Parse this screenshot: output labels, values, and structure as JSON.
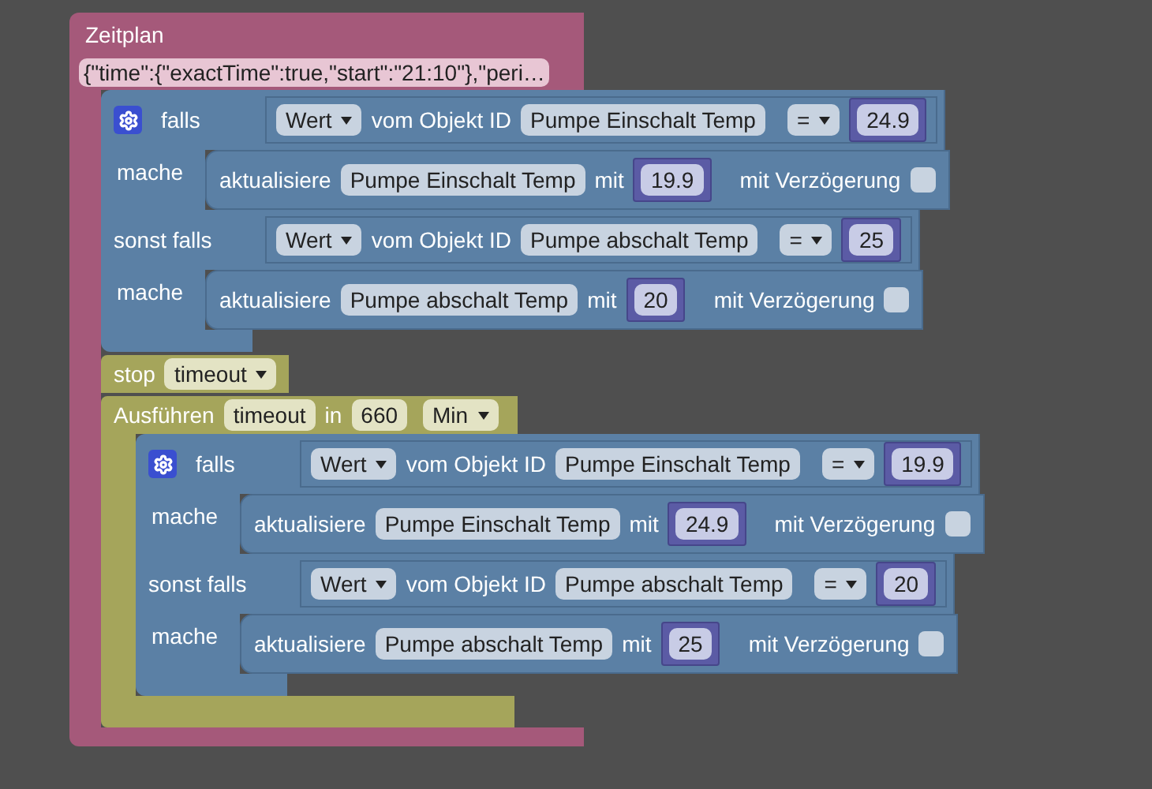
{
  "schedule": {
    "title": "Zeitplan",
    "config": "{\"time\":{\"exactTime\":true,\"start\":\"21:10\"},\"peri…",
    "statements": [
      {
        "kind": "if",
        "branches": [
          {
            "keyword": "falls",
            "condition": {
              "property": "Wert",
              "label": "vom Objekt ID",
              "object": "Pumpe Einschalt Temp",
              "operator": "=",
              "value": "24.9"
            },
            "action_keyword": "mache",
            "action": {
              "label": "aktualisiere",
              "object": "Pumpe Einschalt Temp",
              "with": "mit",
              "value": "19.9",
              "delay_label": "mit Verzögerung",
              "delay": false
            }
          },
          {
            "keyword": "sonst falls",
            "condition": {
              "property": "Wert",
              "label": "vom Objekt ID",
              "object": "Pumpe abschalt Temp",
              "operator": "=",
              "value": "25"
            },
            "action_keyword": "mache",
            "action": {
              "label": "aktualisiere",
              "object": "Pumpe abschalt Temp",
              "with": "mit",
              "value": "20",
              "delay_label": "mit Verzögerung",
              "delay": false
            }
          }
        ]
      },
      {
        "kind": "stop",
        "label": "stop",
        "timer": "timeout"
      },
      {
        "kind": "timeout",
        "label": "Ausführen",
        "timer": "timeout",
        "in": "in",
        "amount": "660",
        "unit": "Min",
        "body": [
          {
            "kind": "if",
            "branches": [
              {
                "keyword": "falls",
                "condition": {
                  "property": "Wert",
                  "label": "vom Objekt ID",
                  "object": "Pumpe Einschalt Temp",
                  "operator": "=",
                  "value": "19.9"
                },
                "action_keyword": "mache",
                "action": {
                  "label": "aktualisiere",
                  "object": "Pumpe Einschalt Temp",
                  "with": "mit",
                  "value": "24.9",
                  "delay_label": "mit Verzögerung",
                  "delay": false
                }
              },
              {
                "keyword": "sonst falls",
                "condition": {
                  "property": "Wert",
                  "label": "vom Objekt ID",
                  "object": "Pumpe abschalt Temp",
                  "operator": "=",
                  "value": "20"
                },
                "action_keyword": "mache",
                "action": {
                  "label": "aktualisiere",
                  "object": "Pumpe abschalt Temp",
                  "with": "mit",
                  "value": "25",
                  "delay_label": "mit Verzögerung",
                  "delay": false
                }
              }
            ]
          }
        ]
      }
    ]
  }
}
